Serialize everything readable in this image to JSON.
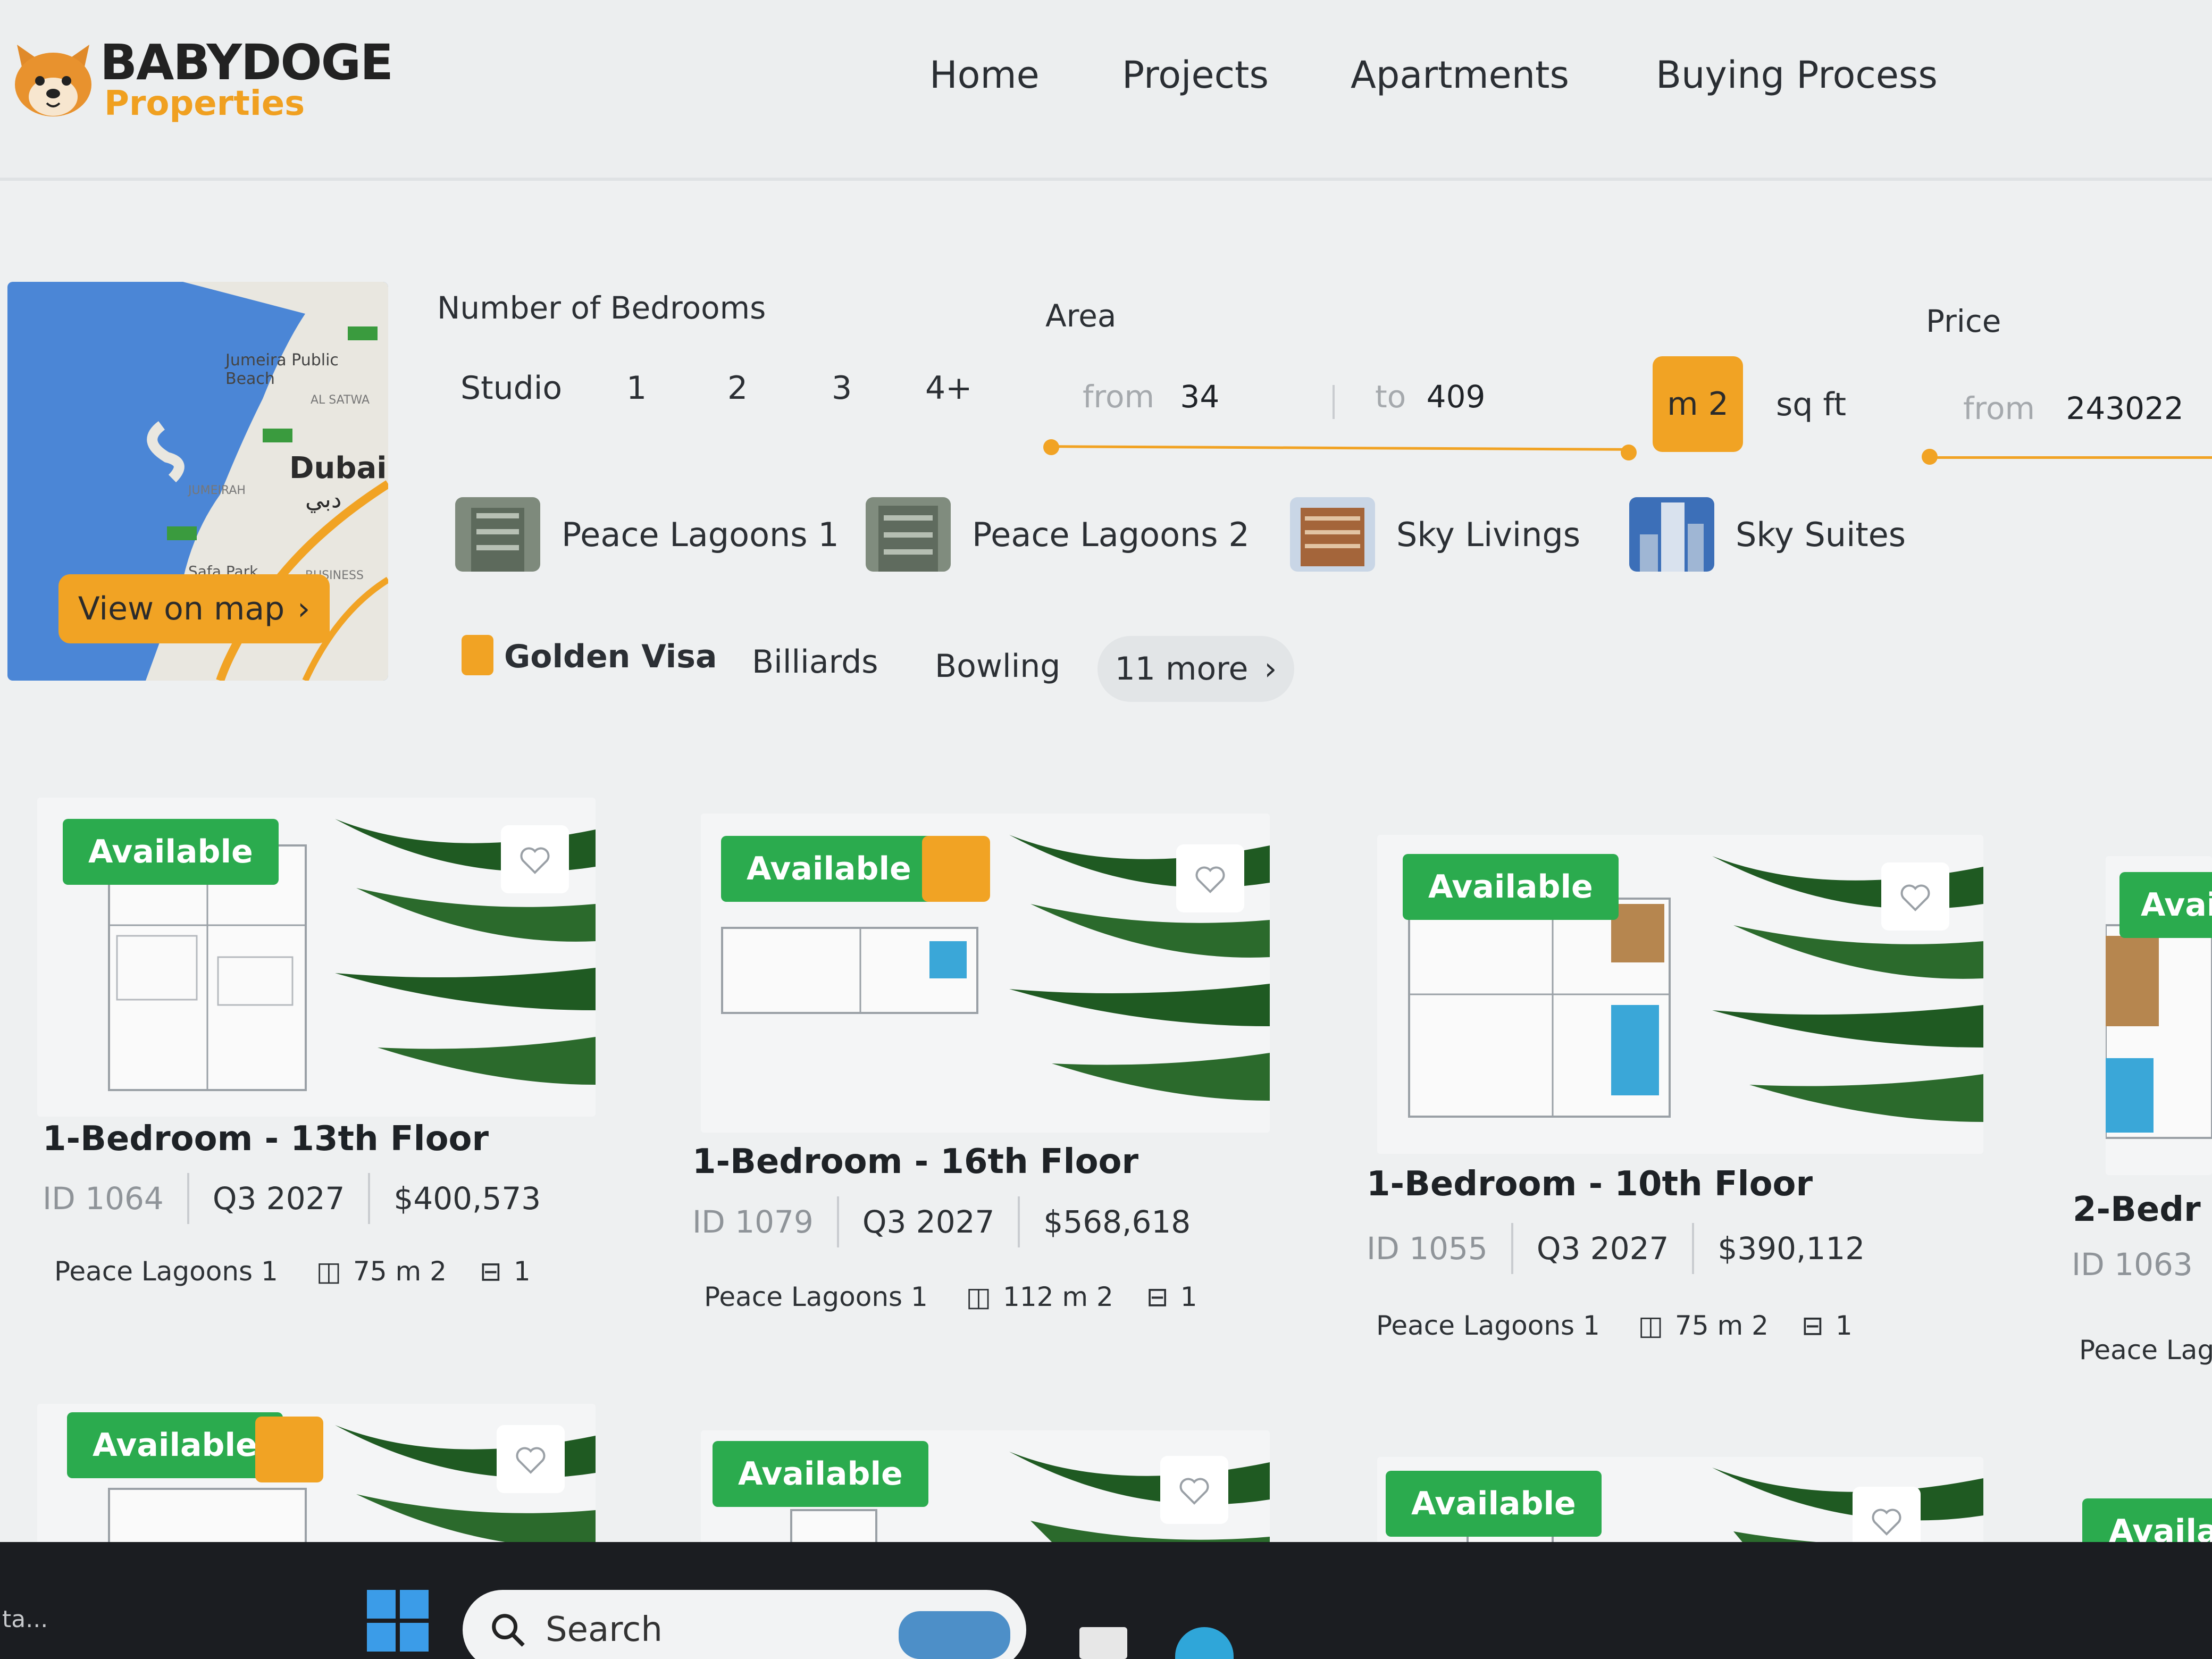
{
  "brand": {
    "name": "BABYDOGE",
    "sub": "Properties"
  },
  "nav": [
    "Home",
    "Projects",
    "Apartments",
    "Buying Process"
  ],
  "map": {
    "places": [
      "Jumeira Public Beach",
      "AL SATWA",
      "Dubai",
      "دبي",
      "Safa Park",
      "JUMEIRAH",
      "BUSINESS BAY"
    ],
    "button": "View on map",
    "button_chevron": "›"
  },
  "filters": {
    "bedrooms": {
      "label": "Number of Bedrooms",
      "options": [
        "Studio",
        "1",
        "2",
        "3",
        "4+"
      ]
    },
    "area": {
      "label": "Area",
      "from_label": "from",
      "from_value": "34",
      "to_label": "to",
      "to_value": "409",
      "unit_m2": "m 2",
      "unit_sqft": "sq ft"
    },
    "price": {
      "label": "Price",
      "from_label": "from",
      "from_value": "243022"
    }
  },
  "projects": [
    "Peace Lagoons 1",
    "Peace Lagoons 2",
    "Sky Livings",
    "Sky Suites"
  ],
  "amenities": {
    "items": [
      "Golden Visa",
      "Billiards",
      "Bowling"
    ],
    "more": "11 more",
    "more_chevron": "›"
  },
  "cards": [
    {
      "badge": "Available",
      "title": "1-Bedroom - 13th Floor",
      "id": "ID 1064",
      "date": "Q3 2027",
      "price": "$400,573",
      "project": "Peace Lagoons 1",
      "area": "75 m 2",
      "bedrooms": "1",
      "golden_visa": false
    },
    {
      "badge": "Available",
      "title": "1-Bedroom - 16th Floor",
      "id": "ID 1079",
      "date": "Q3 2027",
      "price": "$568,618",
      "project": "Peace Lagoons 1",
      "area": "112 m 2",
      "bedrooms": "1",
      "golden_visa": true
    },
    {
      "badge": "Available",
      "title": "1-Bedroom - 10th Floor",
      "id": "ID 1055",
      "date": "Q3 2027",
      "price": "$390,112",
      "project": "Peace Lagoons 1",
      "area": "75 m 2",
      "bedrooms": "1",
      "golden_visa": false
    },
    {
      "badge": "Avai",
      "title": "2-Bedr",
      "id": "ID 1063",
      "project": "Peace Lag"
    }
  ],
  "cards_row2": [
    {
      "badge": "Available",
      "golden_visa": true
    },
    {
      "badge": "Available",
      "golden_visa": false
    },
    {
      "badge": "Available",
      "golden_visa": false
    },
    {
      "badge": "Availa",
      "golden_visa": false
    }
  ],
  "taskbar": {
    "search": "Search",
    "left_text": "ta..."
  },
  "colors": {
    "accent": "#f1a324",
    "available": "#2bab4e"
  }
}
